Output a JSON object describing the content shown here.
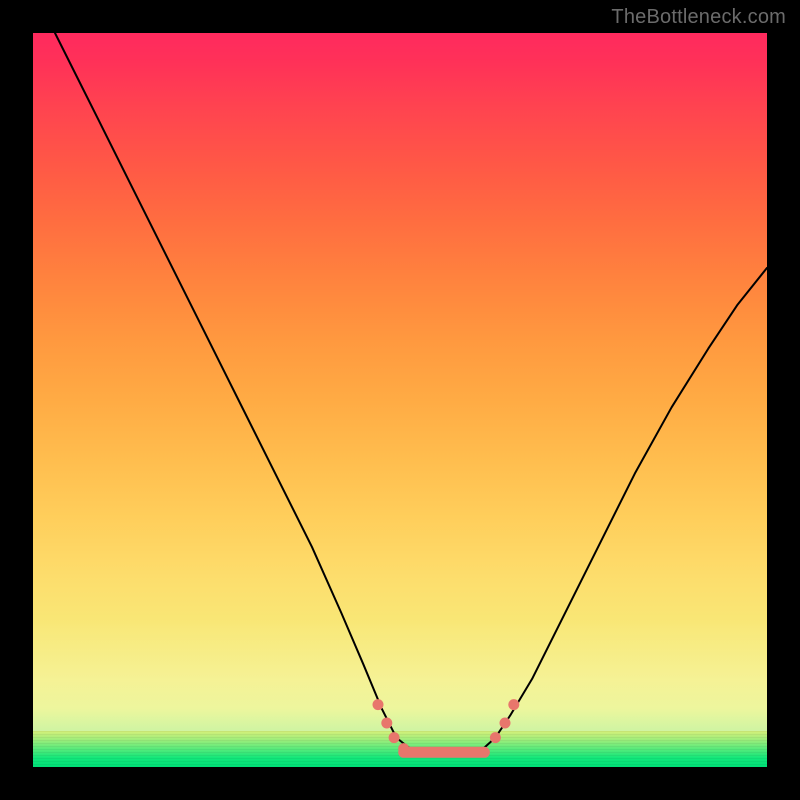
{
  "attribution": "TheBottleneck.com",
  "chart_data": {
    "type": "line",
    "title": "",
    "xlabel": "",
    "ylabel": "",
    "xlim": [
      0,
      100
    ],
    "ylim": [
      0,
      100
    ],
    "grid": false,
    "curve_points": [
      {
        "x": 3.0,
        "y": 100.0
      },
      {
        "x": 6.0,
        "y": 94.0
      },
      {
        "x": 9.0,
        "y": 88.0
      },
      {
        "x": 13.0,
        "y": 80.0
      },
      {
        "x": 18.0,
        "y": 70.0
      },
      {
        "x": 23.0,
        "y": 60.0
      },
      {
        "x": 28.0,
        "y": 50.0
      },
      {
        "x": 33.0,
        "y": 40.0
      },
      {
        "x": 38.0,
        "y": 30.0
      },
      {
        "x": 42.0,
        "y": 21.0
      },
      {
        "x": 45.0,
        "y": 14.0
      },
      {
        "x": 47.5,
        "y": 8.0
      },
      {
        "x": 49.5,
        "y": 4.0
      },
      {
        "x": 52.0,
        "y": 2.0
      },
      {
        "x": 55.0,
        "y": 1.6
      },
      {
        "x": 58.0,
        "y": 1.6
      },
      {
        "x": 61.0,
        "y": 2.2
      },
      {
        "x": 63.0,
        "y": 4.0
      },
      {
        "x": 65.0,
        "y": 7.0
      },
      {
        "x": 68.0,
        "y": 12.0
      },
      {
        "x": 72.0,
        "y": 20.0
      },
      {
        "x": 77.0,
        "y": 30.0
      },
      {
        "x": 82.0,
        "y": 40.0
      },
      {
        "x": 87.0,
        "y": 49.0
      },
      {
        "x": 92.0,
        "y": 57.0
      },
      {
        "x": 96.0,
        "y": 63.0
      },
      {
        "x": 100.0,
        "y": 68.0
      }
    ],
    "valley_markers": [
      {
        "x": 47.0,
        "y": 8.5
      },
      {
        "x": 48.2,
        "y": 6.0
      },
      {
        "x": 49.2,
        "y": 4.0
      },
      {
        "x": 50.5,
        "y": 2.5
      },
      {
        "x": 63.0,
        "y": 4.0
      },
      {
        "x": 64.3,
        "y": 6.0
      },
      {
        "x": 65.5,
        "y": 8.5
      }
    ],
    "valley_bar": {
      "x_start": 50.5,
      "x_end": 61.5,
      "y": 2.0
    },
    "marker_color": "#e8766c",
    "curve_color": "#000000"
  }
}
